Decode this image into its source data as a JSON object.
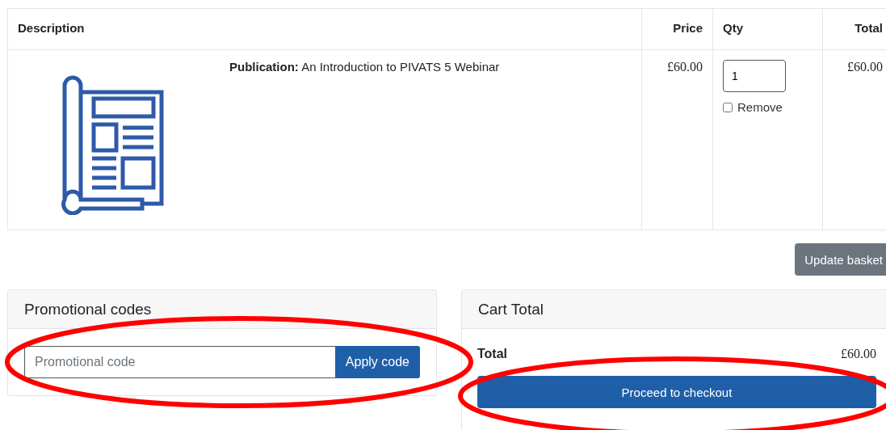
{
  "table": {
    "columns": [
      "Description",
      "Price",
      "Qty",
      "Total"
    ],
    "rows": [
      {
        "kind": "picture",
        "label": "Publication:",
        "title": "An Introduction to PIVATS 5 Webinar",
        "price": "£60.00",
        "qty": "1",
        "remove": {
          "label": "Remove",
          "checked": false
        },
        "total": "£60.00"
      }
    ]
  },
  "update_button": "Update basket",
  "promo": {
    "title": "Promotional codes",
    "placeholder": "Promotional code",
    "button": "Apply code"
  },
  "cart": {
    "title": "Cart Total",
    "total_label": "Total",
    "total_value": "£60.00",
    "button": "Proceed to checkout"
  },
  "highlights": [
    {
      "kind": "ellipse"
    },
    {
      "kind": "ellipse"
    }
  ]
}
